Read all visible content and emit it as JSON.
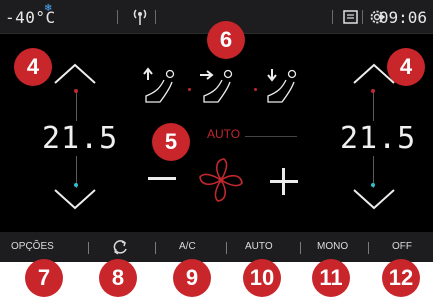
{
  "status_bar": {
    "outside_temp": "-40°C",
    "clock": "09:06"
  },
  "climate": {
    "left_temp": "21.5",
    "right_temp": "21.5",
    "mode_label": "AUTO"
  },
  "bottom_bar": {
    "options_label": "OPÇÕES",
    "ac_label": "A/C",
    "auto_label": "AUTO",
    "mono_label": "MONO",
    "off_label": "OFF"
  },
  "callouts": {
    "c4_left": "4",
    "c4_right": "4",
    "c5": "5",
    "c6": "6",
    "c7": "7",
    "c8": "8",
    "c9": "9",
    "c10": "10",
    "c11": "11",
    "c12": "12"
  },
  "colors": {
    "accent_red": "#c0282e",
    "callout_red": "#c8262b",
    "indicator_cyan": "#2fc0c8",
    "background": "#000000"
  },
  "icons": [
    "snowflake-icon",
    "radio-antenna-icon",
    "message-icon",
    "gear-icon",
    "recirculation-icon",
    "fan-icon",
    "seat-airflow-upper-icon",
    "seat-airflow-center-icon",
    "seat-airflow-lower-icon"
  ]
}
